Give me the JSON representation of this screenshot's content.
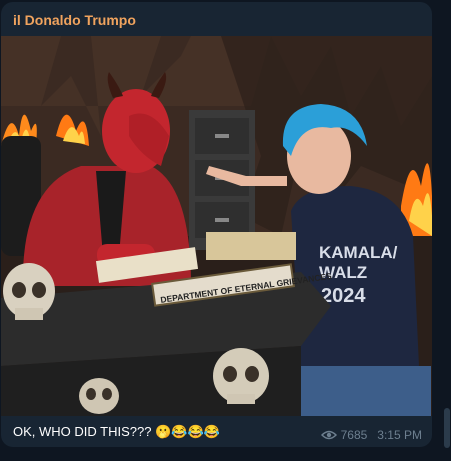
{
  "message": {
    "sender_name": "il Donaldo Trumpo",
    "caption_text": "OK, WHO DID THIS??? 🫢😂😂😂",
    "views": "7685",
    "time": "3:15 PM",
    "views_icon": "eye-icon"
  },
  "image": {
    "nameplate_text": "DEPARTMENT OF ETERNAL GRIEVANCES",
    "shirt_line1": "KAMALA/",
    "shirt_line2": "WALZ",
    "shirt_line3": "2024"
  },
  "colors": {
    "background": "#0e1621",
    "bubble": "#182533",
    "sender_accent": "#f0a35e",
    "meta_text": "#6d7f8f"
  }
}
